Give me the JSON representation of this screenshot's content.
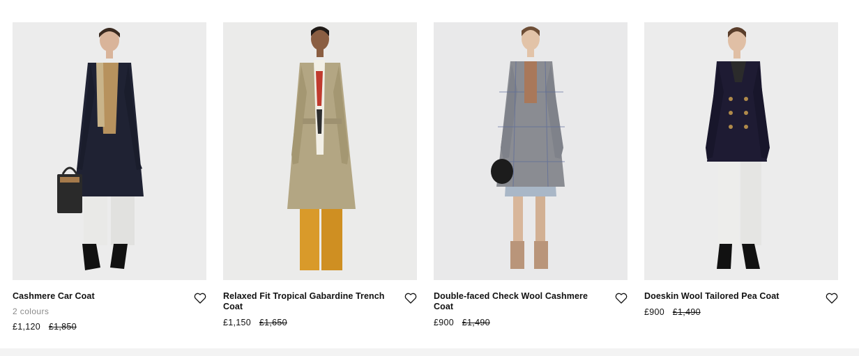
{
  "products": [
    {
      "name": "Cashmere Car Coat",
      "colours": "2 colours",
      "price": "£1,120",
      "was_price": "£1,850",
      "coat_color": "#1f2233",
      "inner_color": "#b7925e",
      "pants_color": "#e9e9e7"
    },
    {
      "name": "Relaxed Fit Tropical Gabardine Trench Coat",
      "colours": "",
      "price": "£1,150",
      "was_price": "£1,650",
      "coat_color": "#b3a683",
      "inner_color": "#c03a2e",
      "pants_color": "#d99a2a"
    },
    {
      "name": "Double-faced Check Wool Cashmere Coat",
      "colours": "",
      "price": "£900",
      "was_price": "£1,490",
      "coat_color": "#8a8c92",
      "inner_color": "#a9785a",
      "pants_color": "#d5b79a"
    },
    {
      "name": "Doeskin Wool Tailored Pea Coat",
      "colours": "",
      "price": "£900",
      "was_price": "£1,490",
      "coat_color": "#1e1b33",
      "inner_color": "#2b2b2b",
      "pants_color": "#ededeb"
    }
  ],
  "icons": {
    "wishlist": "heart-outline-icon"
  },
  "colors": {
    "image_bg": "#ebebeb",
    "text": "#111111",
    "muted": "#8a8a8a"
  }
}
